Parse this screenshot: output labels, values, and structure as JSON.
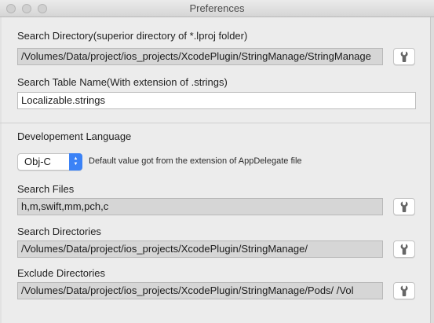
{
  "window": {
    "title": "Preferences"
  },
  "search_directory": {
    "label": "Search Directory(superior directory of *.lproj folder)",
    "value": "/Volumes/Data/project/ios_projects/XcodePlugin/StringManage/StringManage"
  },
  "search_table": {
    "label": "Search Table Name(With extension of .strings)",
    "value": "Localizable.strings"
  },
  "development_language": {
    "label": "Developement Language",
    "selected": "Obj-C",
    "hint": "Default value got from the extension of AppDelegate file",
    "accent_color": "#3b82f6"
  },
  "search_files": {
    "label": "Search Files",
    "value": "h,m,swift,mm,pch,c"
  },
  "search_directories": {
    "label": "Search Directories",
    "value": "/Volumes/Data/project/ios_projects/XcodePlugin/StringManage/"
  },
  "exclude_directories": {
    "label": "Exclude Directories",
    "value": "/Volumes/Data/project/ios_projects/XcodePlugin/StringManage/Pods/    /Vol"
  },
  "icons": {
    "edit_button": "wrench-icon"
  }
}
